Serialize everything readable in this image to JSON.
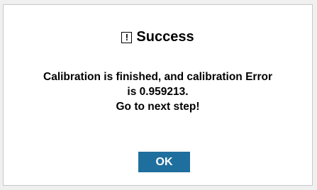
{
  "dialog": {
    "icon": "exclamation-box-icon",
    "icon_glyph": "!",
    "title": "Success",
    "message_lines": [
      "Calibration is finished, and calibration Error",
      "is 0.959213.",
      "Go to next step!"
    ],
    "ok_label": "OK"
  },
  "colors": {
    "ok_button_bg": "#1f6f9e",
    "ok_button_text": "#ffffff"
  }
}
